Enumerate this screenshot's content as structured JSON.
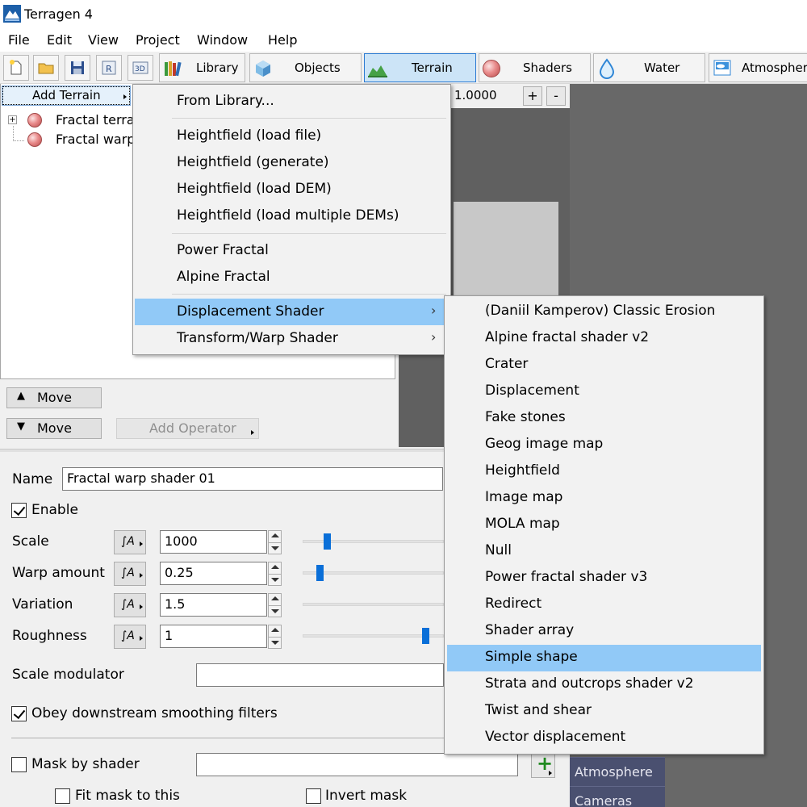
{
  "window": {
    "title": "Terragen 4"
  },
  "menubar": [
    "File",
    "Edit",
    "View",
    "Project",
    "Window",
    "Help"
  ],
  "toolbar": {
    "tabs": [
      {
        "label": "Library",
        "icon": "books-icon"
      },
      {
        "label": "Objects",
        "icon": "cube-icon"
      },
      {
        "label": "Terrain",
        "icon": "terrain-icon",
        "active": true
      },
      {
        "label": "Shaders",
        "icon": "sphere-icon"
      },
      {
        "label": "Water",
        "icon": "water-drop-icon"
      },
      {
        "label": "Atmosphere",
        "icon": "sky-icon"
      }
    ]
  },
  "node_panel": {
    "add_button": "Add Terrain",
    "tree": [
      {
        "label": "Fractal terrai",
        "expandable": true
      },
      {
        "label": "Fractal warp",
        "expandable": false,
        "selected": true
      }
    ],
    "move_up": "Move",
    "move_down": "Move",
    "add_operator": "Add Operator"
  },
  "viewport": {
    "zoom": "1.0000",
    "plus": "+",
    "minus": "-"
  },
  "properties": {
    "name_label": "Name",
    "name_value": "Fractal warp shader 01",
    "enable_label": "Enable",
    "enable": true,
    "params": [
      {
        "label": "Scale",
        "value": "1000",
        "slider": 0.17
      },
      {
        "label": "Warp amount",
        "value": "0.25",
        "slider": 0.12
      },
      {
        "label": "Variation",
        "value": "1.5",
        "slider": null
      },
      {
        "label": "Roughness",
        "value": "1",
        "slider": 0.87
      }
    ],
    "scale_modulator_label": "Scale modulator",
    "obey_label": "Obey downstream smoothing filters",
    "obey": true,
    "mask_label": "Mask by shader",
    "mask": false,
    "fit_mask_label": "Fit mask to this",
    "invert_mask_label": "Invert mask"
  },
  "side_tabs": [
    "Atmosphere",
    "Cameras"
  ],
  "add_menu": {
    "items": [
      "From Library...",
      "Heightfield (load file)",
      "Heightfield (generate)",
      "Heightfield (load DEM)",
      "Heightfield (load multiple DEMs)",
      "Power Fractal",
      "Alpine Fractal",
      "Displacement Shader",
      "Transform/Warp Shader"
    ],
    "highlighted": "Displacement Shader"
  },
  "displacement_submenu": {
    "items": [
      "(Daniil Kamperov) Classic Erosion",
      "Alpine fractal shader v2",
      "Crater",
      "Displacement",
      "Fake stones",
      "Geog image map",
      "Heightfield",
      "Image map",
      "MOLA map",
      "Null",
      "Power fractal shader v3",
      "Redirect",
      "Shader array",
      "Simple shape",
      "Strata and outcrops shader v2",
      "Twist and shear",
      "Vector displacement"
    ],
    "highlighted": "Simple shape"
  },
  "colors": {
    "accent": "#0a6fd8",
    "menu_highlight": "#91c9f7",
    "active_tab": "#cce4f7",
    "side_tab": "#4a5070",
    "viewport_bg": "#606060"
  }
}
